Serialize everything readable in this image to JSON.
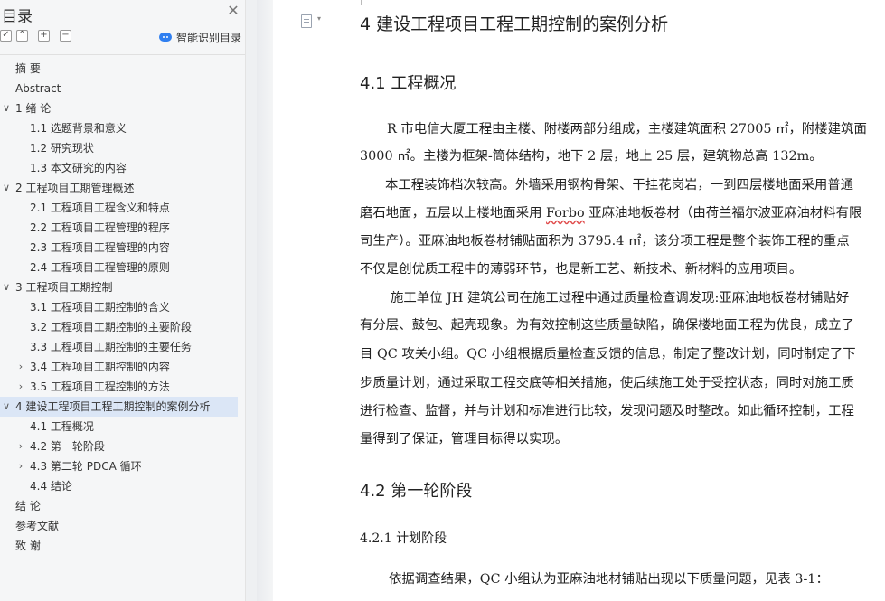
{
  "nav": {
    "title": "目录",
    "close_glyph": "✕",
    "ai_toc_label": "智能识别目录",
    "items": [
      {
        "label": "摘  要"
      },
      {
        "label": "Abstract"
      },
      {
        "label": "1 绪  论"
      },
      {
        "label": "1.1 选题背景和意义"
      },
      {
        "label": "1.2 研究现状"
      },
      {
        "label": "1.3 本文研究的内容"
      },
      {
        "label": "2 工程项目工期管理概述"
      },
      {
        "label": "2.1 工程项目工程含义和特点"
      },
      {
        "label": "2.2 工程项目工程管理的程序"
      },
      {
        "label": "2.3 工程项目工程管理的内容"
      },
      {
        "label": "2.4 工程项目工程管理的原则"
      },
      {
        "label": "3 工程项目工期控制"
      },
      {
        "label": "3.1 工程项目工期控制的含义"
      },
      {
        "label": "3.2 工程项目工期控制的主要阶段"
      },
      {
        "label": "3.3 工程项目工期控制的主要任务"
      },
      {
        "label": "3.4 工程项目工期控制的内容"
      },
      {
        "label": "3.5 工程项目工程控制的方法"
      },
      {
        "label": "4 建设工程项目工程工期控制的案例分析"
      },
      {
        "label": "4.1 工程概况"
      },
      {
        "label": "4.2 第一轮阶段"
      },
      {
        "label": "4.3 第二轮 PDCA 循环"
      },
      {
        "label": "4.4 结论"
      },
      {
        "label": "结  论"
      },
      {
        "label": "参考文献"
      },
      {
        "label": "致  谢"
      }
    ]
  },
  "doc": {
    "chapter_title": "4 建设工程项目工程工期控制的案例分析",
    "s41_title": "4.1 工程概况",
    "p1_l1": "R 市电信大厦工程由主楼、附楼两部分组成，主楼建筑面积 27005 ㎡，附楼建筑面",
    "p1_l2": "3000 ㎡。主楼为框架-筒体结构，地下 2 层，地上 25 层，建筑物总高 132m。",
    "p2_l1": "本工程装饰档次较高。外墙采用钢构骨架、干挂花岗岩，一到四层楼地面采用普通",
    "p2_l2_a": "磨石地面，五层以上楼地面采用 ",
    "p2_l2_b": "Forbo",
    "p2_l2_c": " 亚麻油地板卷材（由荷兰福尔波亚麻油材料有限",
    "p2_l3": "司生产）。亚麻油地板卷材铺贴面积为  3795.4 ㎡，该分项工程是整个装饰工程的重点",
    "p2_l4": "不仅是创优质工程中的薄弱环节，也是新工艺、新技术、新材料的应用项目。",
    "p3_l1": "施工单位 JH 建筑公司在施工过程中通过质量检查调发现:亚麻油地板卷材铺贴好",
    "p3_l2": "有分层、鼓包、起壳现象。为有效控制这些质量缺陷，确保楼地面工程为优良，成立了",
    "p3_l3": "目 QC 攻关小组。QC 小组根据质量检查反馈的信息，制定了整改计划，同时制定了下",
    "p3_l4": "步质量计划，通过采取工程交底等相关措施，使后续施工处于受控状态，同时对施工质",
    "p3_l5": "进行检查、监督，并与计划和标准进行比较，发现问题及时整改。如此循环控制，工程",
    "p3_l6": "量得到了保证，管理目标得以实现。",
    "s42_title": "4.2 第一轮阶段",
    "s421_title": "4.2.1 计划阶段",
    "p4_l1": "依据调查结果，QC 小组认为亚麻油地材铺贴出现以下质量问题，见表 3-1："
  }
}
